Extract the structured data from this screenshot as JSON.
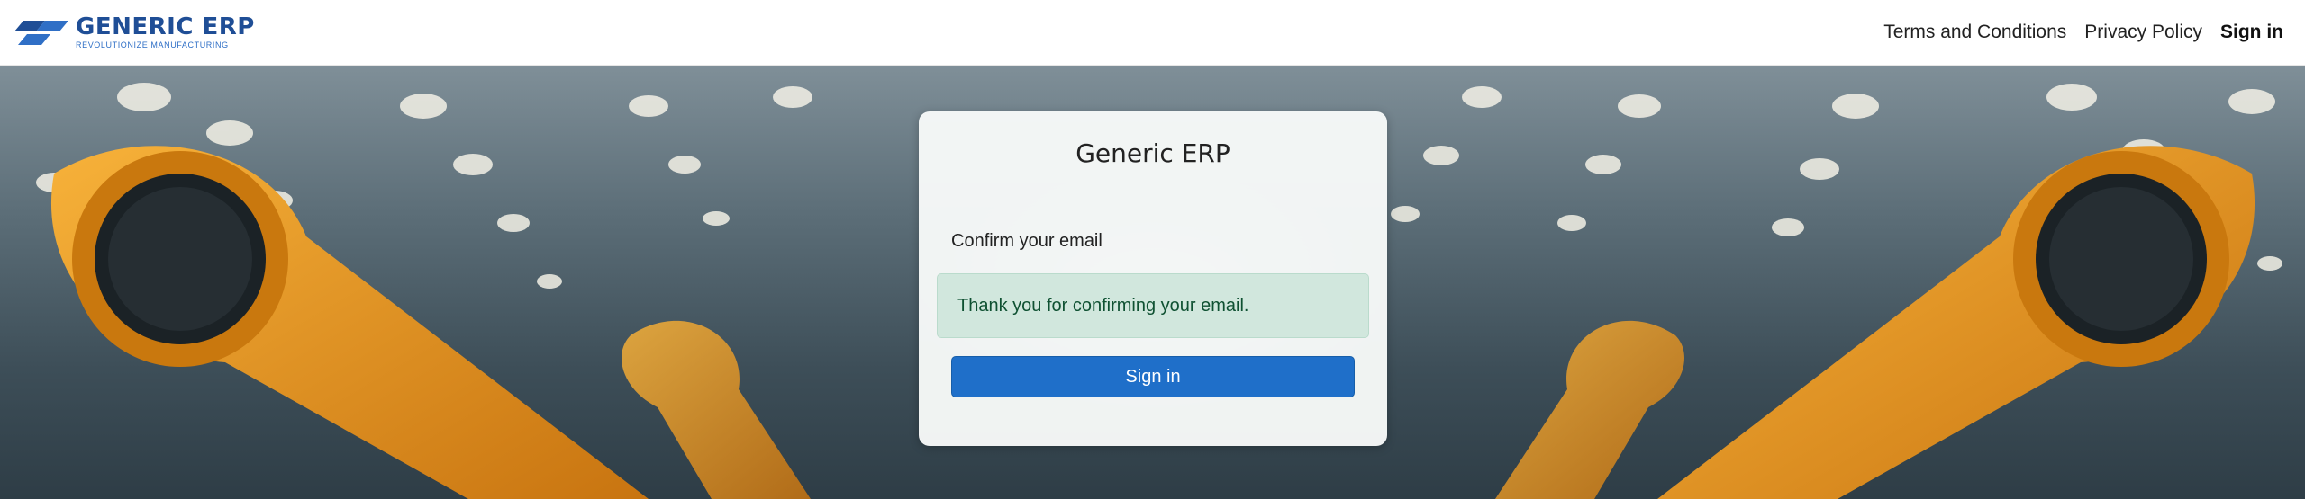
{
  "brand": {
    "name": "GENERIC ERP",
    "tagline": "REVOLUTIONIZE MANUFACTURING",
    "colors": {
      "primary": "#1f4e96",
      "secondary": "#2f6fc6"
    }
  },
  "nav": {
    "links": [
      {
        "label": "Terms and Conditions"
      },
      {
        "label": "Privacy Policy"
      },
      {
        "label": "Sign in"
      }
    ]
  },
  "hero": {
    "image": "factory-robot-arms-icon"
  },
  "card": {
    "title": "Generic ERP",
    "subtitle": "Confirm your email",
    "alert": {
      "message": "Thank you for confirming your email.",
      "color": "#d1e7dd"
    },
    "button": {
      "label": "Sign in",
      "color": "#1f6fc9"
    }
  }
}
